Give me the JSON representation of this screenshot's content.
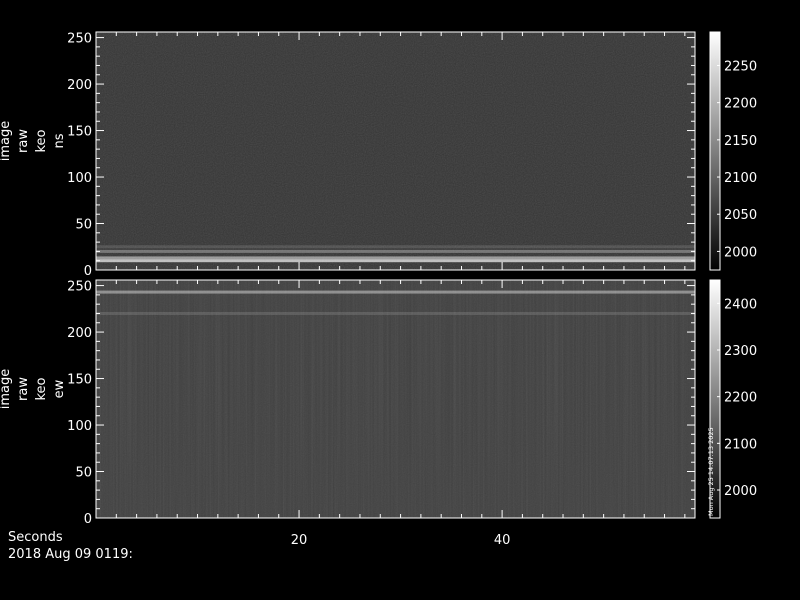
{
  "chart_data": [
    {
      "type": "heatmap",
      "ylabel": [
        "image",
        "raw",
        "keo",
        "ns"
      ],
      "x_range": [
        0,
        59
      ],
      "ylim": [
        0,
        256
      ],
      "yticks": [
        0,
        50,
        100,
        150,
        200,
        250
      ],
      "colorbar": {
        "range": [
          1975,
          2295
        ],
        "ticks": [
          2000,
          2050,
          2100,
          2150,
          2200,
          2250
        ]
      },
      "bright_rows": [
        {
          "y": 10,
          "value": 2250
        },
        {
          "y": 13,
          "value": 2190
        },
        {
          "y": 20,
          "value": 2130
        },
        {
          "y": 25,
          "value": 2080
        }
      ],
      "background_value": 2040
    },
    {
      "type": "heatmap",
      "ylabel": [
        "image",
        "raw",
        "keo",
        "ew"
      ],
      "x_range": [
        0,
        59
      ],
      "ylim": [
        0,
        256
      ],
      "yticks": [
        0,
        50,
        100,
        150,
        200,
        250
      ],
      "colorbar": {
        "range": [
          1940,
          2450
        ],
        "ticks": [
          2000,
          2100,
          2200,
          2300,
          2400
        ]
      },
      "bright_rows": [
        {
          "y": 243,
          "value": 2250
        },
        {
          "y": 220,
          "value": 2120
        }
      ],
      "background_value": 2060
    }
  ],
  "xaxis": {
    "label": "Seconds",
    "ticks": [
      20,
      40
    ]
  },
  "timestamp": "2018 Aug 09 0119:",
  "footer_stamp": "Mon Aug 25 14:07:13 2025"
}
